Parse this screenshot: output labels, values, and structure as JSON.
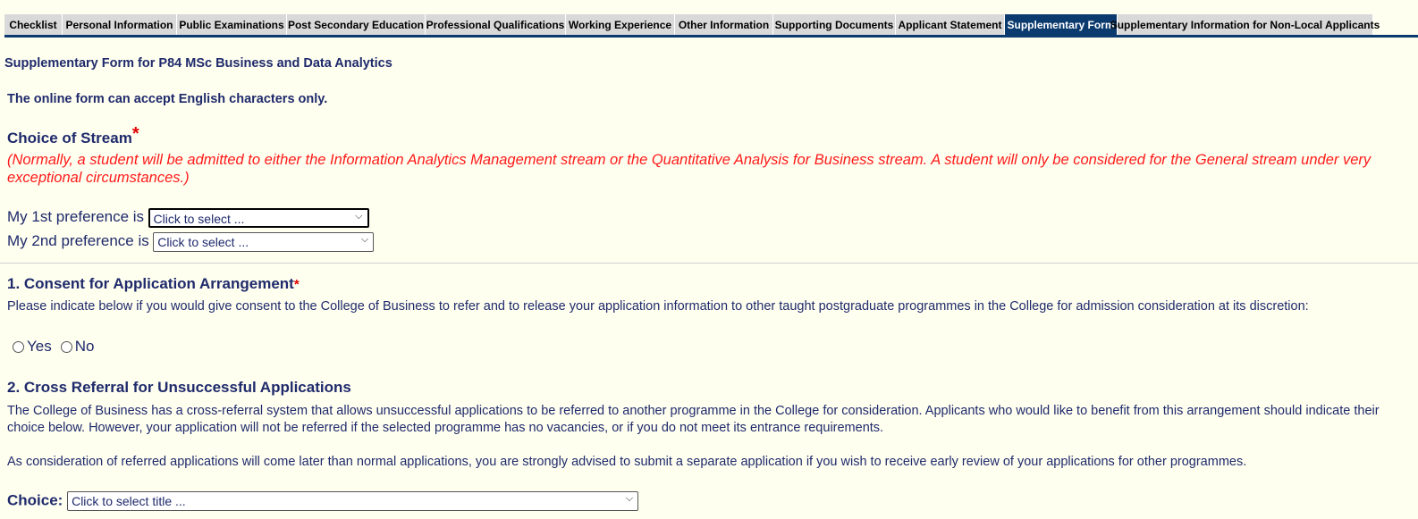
{
  "tabs": [
    {
      "label": "Checklist",
      "active": false
    },
    {
      "label": "Personal Information",
      "active": false
    },
    {
      "label": "Public Examinations",
      "active": false
    },
    {
      "label": "Post Secondary Education",
      "active": false
    },
    {
      "label": "Professional Qualifications",
      "active": false
    },
    {
      "label": "Working Experience",
      "active": false
    },
    {
      "label": "Other Information",
      "active": false
    },
    {
      "label": "Supporting Documents",
      "active": false
    },
    {
      "label": "Applicant Statement",
      "active": false
    },
    {
      "label": "Supplementary Form",
      "active": true
    },
    {
      "label": "Supplementary Information for Non-Local Applicants",
      "active": false
    }
  ],
  "form": {
    "title": "Supplementary Form for P84 MSc Business and Data Analytics",
    "notice": "The online form can accept English characters only."
  },
  "stream": {
    "heading": "Choice of Stream",
    "required_mark": "*",
    "note": "(Normally, a student will be admitted to either the Information Analytics Management stream or the Quantitative Analysis for Business stream. A student will only be considered for the General stream under very exceptional circumstances.)",
    "pref1_label": "My 1st preference is",
    "pref1_value": "Click to select ...",
    "pref2_label": "My 2nd preference is",
    "pref2_value": "Click to select ..."
  },
  "consent": {
    "heading": "1. Consent for Application Arrangement",
    "required_mark": "*",
    "text": "Please indicate below if you would give consent to the College of Business to refer and to release your application information to other taught postgraduate programmes in the College for admission consideration at its discretion:",
    "yes_label": "Yes",
    "no_label": "No"
  },
  "cross_referral": {
    "heading": "2. Cross Referral for Unsuccessful Applications",
    "text1": "The College of Business has a cross-referral system that allows unsuccessful applications to be referred to another programme in the College for consideration. Applicants who would like to benefit from this arrangement should indicate their choice below. However, your application will not be referred if the selected programme has no vacancies, or if you do not meet its entrance requirements.",
    "text2": "As consideration of referred applications will come later than normal applications, you are strongly advised to submit a separate application if you wish to receive early review of your applications for other programmes.",
    "choice_label": "Choice:",
    "choice_value": "Click to select title ..."
  },
  "icons": {
    "dropdown": "chevron-down-icon",
    "radio": "radio-unchecked-icon"
  },
  "colors": {
    "tab_active": "#0b3a6e",
    "tab_inactive": "#d9d9d9",
    "text": "#1f2a6b",
    "required": "#e00000",
    "note": "#ff1a1a",
    "background": "#fffff0"
  }
}
